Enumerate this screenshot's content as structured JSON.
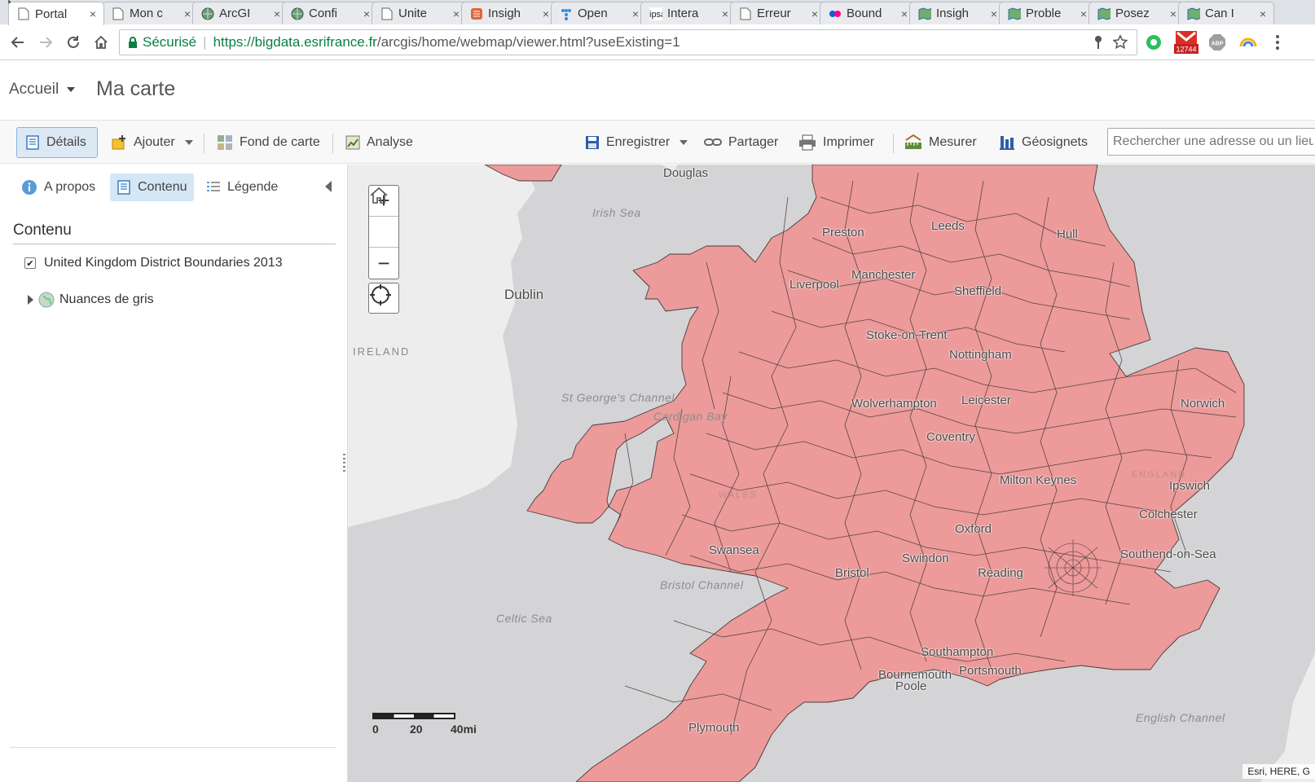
{
  "browser": {
    "tabs": [
      {
        "title": "Portal",
        "icon": "page-icon"
      },
      {
        "title": "Mon c",
        "icon": "page-icon"
      },
      {
        "title": "ArcGI",
        "icon": "globe-icon"
      },
      {
        "title": "Confi",
        "icon": "globe-icon"
      },
      {
        "title": "Unite",
        "icon": "page-icon"
      },
      {
        "title": "Insigh",
        "icon": "insights-icon"
      },
      {
        "title": "Open",
        "icon": "open-data-icon"
      },
      {
        "title": "Intera",
        "icon": "ipsa-icon",
        "icon_text": "ipsa"
      },
      {
        "title": "Erreur",
        "icon": "page-icon"
      },
      {
        "title": "Bound",
        "icon": "flickr-icon"
      },
      {
        "title": "Insigh",
        "icon": "map-icon"
      },
      {
        "title": "Proble",
        "icon": "map-icon"
      },
      {
        "title": "Posez",
        "icon": "map-icon"
      },
      {
        "title": "Can I",
        "icon": "map-icon"
      }
    ],
    "close_glyph": "×",
    "secure_label": "Sécurisé",
    "url_host": "https://bigdata.esrifrance.fr",
    "url_path": "/arcgis/home/webmap/viewer.html?useExisting=1",
    "gmail_badge": "12744",
    "abp_label": "ABP"
  },
  "app": {
    "home_menu": "Accueil",
    "map_title": "Ma carte"
  },
  "toolbar": {
    "details": "Détails",
    "add": "Ajouter",
    "basemap": "Fond de carte",
    "analysis": "Analyse",
    "save": "Enregistrer",
    "share": "Partager",
    "print": "Imprimer",
    "measure": "Mesurer",
    "bookmarks": "Géosignets",
    "search_placeholder": "Rechercher une adresse ou un lieu"
  },
  "panel": {
    "tabs": {
      "about": "A propos",
      "content": "Contenu",
      "legend": "Légende"
    },
    "heading": "Contenu",
    "layers": [
      {
        "name": "United Kingdom District Boundaries 2013",
        "checked": true
      },
      {
        "name": "Nuances de gris",
        "checked": false
      }
    ]
  },
  "map": {
    "cities": [
      "Douglas",
      "Preston",
      "Leeds",
      "Hull",
      "Manchester",
      "Liverpool",
      "Sheffield",
      "Dublin",
      "Stoke-on-Trent",
      "Nottingham",
      "Wolverhampton",
      "Leicester",
      "Norwich",
      "Coventry",
      "Milton Keynes",
      "Ipswich",
      "Colchester",
      "Oxford",
      "Swansea",
      "Swindon",
      "Southend-on-Sea",
      "Bristol",
      "Reading",
      "Southampton",
      "Bournemouth",
      "Portsmouth",
      "Poole",
      "Plymouth"
    ],
    "seas": [
      "Irish Sea",
      "St George's Channel",
      "Cardigan Bay",
      "Bristol Channel",
      "Celtic Sea",
      "English Channel"
    ],
    "countries": [
      "IRELAND",
      "WALES",
      "ENGLAND"
    ],
    "scale": {
      "ticks": [
        "0",
        "20",
        "40mi"
      ]
    },
    "attribution": "Esri, HERE, G",
    "colors": {
      "fill": "#ec9a9a",
      "border": "#4a3a3a",
      "water": "#d4d4d6",
      "land_grey": "#ededed"
    }
  },
  "page_colors": {
    "accent_active": "#dce9f5",
    "secure_green": "#0b8043"
  }
}
